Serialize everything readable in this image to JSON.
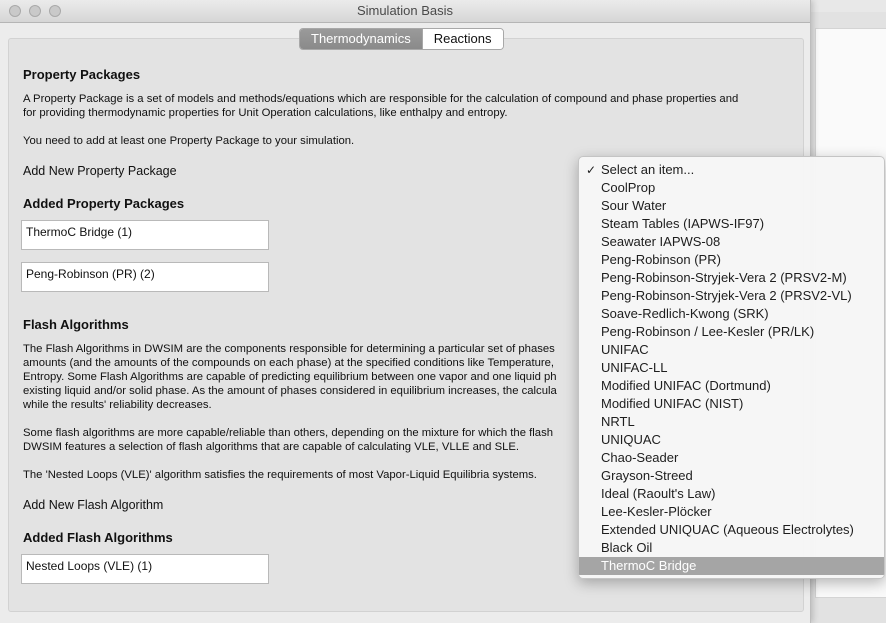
{
  "window": {
    "title": "Simulation Basis"
  },
  "tabs": [
    {
      "label": "Thermodynamics",
      "active": true
    },
    {
      "label": "Reactions",
      "active": false
    }
  ],
  "property_packages": {
    "heading": "Property Packages",
    "desc_line1": "A Property Package is a set of models and methods/equations which are responsible for the calculation of compound and phase properties and",
    "desc_line2": "for providing thermodynamic properties for Unit Operation calculations, like enthalpy and entropy.",
    "note": "You need to add at least one Property Package to your simulation.",
    "add_label": "Add New Property Package",
    "added_heading": "Added Property Packages",
    "added": [
      "ThermoC Bridge (1)",
      "Peng-Robinson (PR) (2)"
    ]
  },
  "flash": {
    "heading": "Flash Algorithms",
    "p1_line1": "The Flash Algorithms in DWSIM are the components responsible for determining a particular set of phases",
    "p1_line2": "amounts (and the amounts of the compounds on each phase) at the specified conditions like Temperature,",
    "p1_line3": "Entropy. Some Flash Algorithms are capable of predicting equilibrium between one vapor and one liquid ph",
    "p1_line4": "existing liquid and/or solid phase. As the amount of phases considered in equilibrium increases, the calcula",
    "p1_line5": "while the results' reliability decreases.",
    "p2_line1": "Some flash algorithms are more capable/reliable than others, depending on the mixture for which the flash",
    "p2_line2": "DWSIM features a selection of flash algorithms that are capable of calculating VLE, VLLE and SLE.",
    "p3": "The 'Nested Loops (VLE)' algorithm satisfies the requirements of most Vapor-Liquid Equilibria systems.",
    "add_label": "Add New Flash Algorithm",
    "added_heading": "Added Flash Algorithms",
    "added": [
      "Nested Loops (VLE) (1)"
    ]
  },
  "dropdown": {
    "check_icon": "✓",
    "items": [
      "Select an item...",
      "CoolProp",
      "Sour Water",
      "Steam Tables (IAPWS-IF97)",
      "Seawater IAPWS-08",
      "Peng-Robinson (PR)",
      "Peng-Robinson-Stryjek-Vera 2 (PRSV2-M)",
      "Peng-Robinson-Stryjek-Vera 2 (PRSV2-VL)",
      "Soave-Redlich-Kwong (SRK)",
      "Peng-Robinson / Lee-Kesler (PR/LK)",
      "UNIFAC",
      "UNIFAC-LL",
      "Modified UNIFAC (Dortmund)",
      "Modified UNIFAC (NIST)",
      "NRTL",
      "UNIQUAC",
      "Chao-Seader",
      "Grayson-Streed",
      "Ideal (Raoult's Law)",
      "Lee-Kesler-Plöcker",
      "Extended UNIQUAC (Aqueous Electrolytes)",
      "Black Oil",
      "ThermoC Bridge"
    ],
    "checked_index": 0,
    "highlighted_index": 22
  },
  "colors": {
    "accent": "#3d82d6",
    "highlight": "#a5a5a5"
  }
}
